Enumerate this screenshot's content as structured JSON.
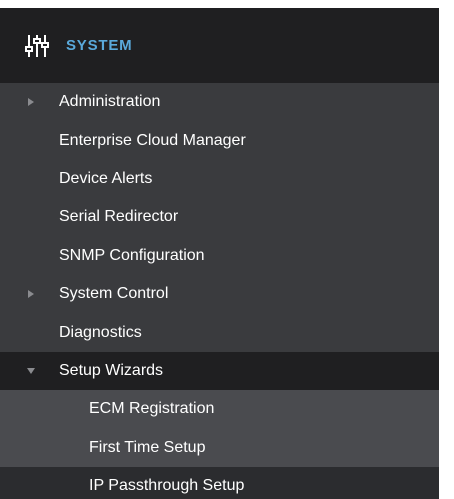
{
  "header": {
    "title": "SYSTEM",
    "icon": "sliders-icon",
    "title_color": "#5aa9db"
  },
  "menu": {
    "items": [
      {
        "label": "Administration",
        "caret": "right"
      },
      {
        "label": "Enterprise Cloud Manager"
      },
      {
        "label": "Device Alerts"
      },
      {
        "label": "Serial Redirector"
      },
      {
        "label": "SNMP Configuration"
      },
      {
        "label": "System Control",
        "caret": "right"
      },
      {
        "label": "Diagnostics"
      },
      {
        "label": "Setup Wizards",
        "caret": "down",
        "expanded": true
      }
    ],
    "subitems": [
      {
        "label": "ECM Registration"
      },
      {
        "label": "First Time Setup"
      },
      {
        "label": "IP Passthrough Setup",
        "selected": true
      }
    ]
  },
  "colors": {
    "panel_bg": "#3a3b3e",
    "header_bg": "#1f1f21",
    "submenu_bg": "#4a4b4f",
    "text": "#ffffff",
    "caret": "#8a8b8f"
  }
}
